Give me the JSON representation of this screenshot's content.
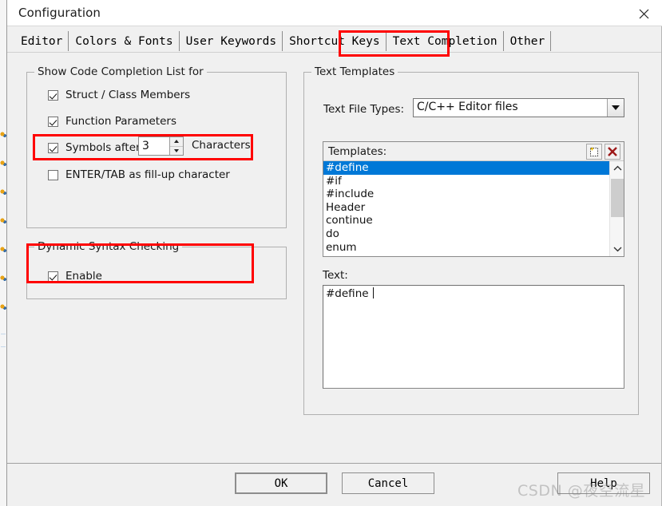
{
  "window": {
    "title": "Configuration",
    "close_icon": "close-x-icon"
  },
  "tabs": [
    {
      "label": "Editor",
      "active": false
    },
    {
      "label": "Colors & Fonts",
      "active": false
    },
    {
      "label": "User Keywords",
      "active": false
    },
    {
      "label": "Shortcut Keys",
      "active": false
    },
    {
      "label": "Text Completion",
      "active": true
    },
    {
      "label": "Other",
      "active": false
    }
  ],
  "code_completion_group": {
    "title": "Show Code Completion List for",
    "checkboxes": [
      {
        "label": "Struct / Class Members",
        "checked": true
      },
      {
        "label": "Function Parameters",
        "checked": true
      },
      {
        "label": "Symbols after",
        "checked": true
      },
      {
        "label": "ENTER/TAB as fill-up character",
        "checked": false
      }
    ],
    "spinner": {
      "value": "3",
      "up_icon": "spinner-up-arrow-icon",
      "down_icon": "spinner-down-arrow-icon"
    },
    "characters_label": "Characters"
  },
  "syntax_group": {
    "title": "Dynamic Syntax Checking",
    "enable": {
      "label": "Enable",
      "checked": true
    }
  },
  "templates_group": {
    "title": "Text Templates",
    "file_types_label": "Text File Types:",
    "file_types_value": "C/C++ Editor files",
    "dropdown_icon": "chevron-down-icon",
    "templates_label": "Templates:",
    "new_icon": "new-template-icon",
    "delete_icon": "delete-template-icon",
    "items": [
      "#define",
      "#if",
      "#include",
      "Header",
      "continue",
      "do",
      "enum"
    ],
    "selected_index": 0,
    "scroll_up_icon": "scroll-up-chevron-icon",
    "scroll_down_icon": "scroll-down-chevron-icon",
    "text_label": "Text:",
    "text_value": "#define "
  },
  "footer": {
    "ok_label": "OK",
    "cancel_label": "Cancel",
    "help_label": "Help"
  },
  "annotations": {
    "color": "#ff0000",
    "boxes": [
      "text-completion-tab",
      "symbols-after-row",
      "dynamic-syntax-checking-group"
    ]
  },
  "watermark": {
    "text": "CSDN @夜空流星"
  }
}
